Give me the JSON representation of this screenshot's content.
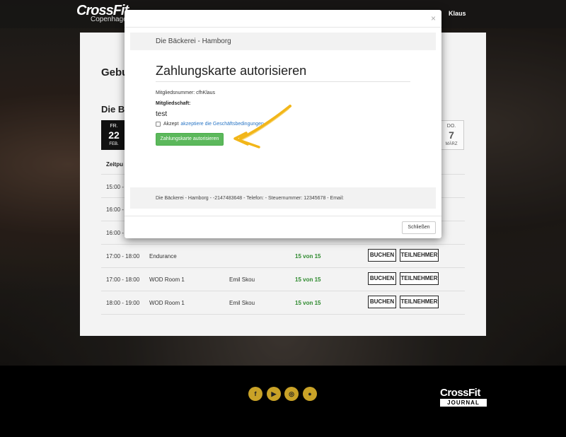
{
  "header": {
    "logo": "CrossFit",
    "logo_sub": "Copenhagen",
    "user": "Klaus"
  },
  "panel": {
    "title": "Gebu",
    "subtitle": "Die Bä",
    "days": [
      {
        "weekday": "FR.",
        "day": "22",
        "month": "FEB.",
        "active": true
      },
      {
        "weekday": "DO.",
        "day": "7",
        "month": "MÄRZ",
        "active": false
      }
    ],
    "table_header": "Zeitpu",
    "rows": [
      {
        "time": "15:00 -",
        "class": "",
        "coach": "",
        "spots": "",
        "book": "",
        "participants": ""
      },
      {
        "time": "16:00 -",
        "class": "",
        "coach": "",
        "spots": "",
        "book": "",
        "participants": ""
      },
      {
        "time": "16:00 -",
        "class": "",
        "coach": "",
        "spots": "",
        "book": "",
        "participants": ""
      },
      {
        "time": "17:00 - 18:00",
        "class": "Endurance",
        "coach": "",
        "spots": "15 von 15",
        "book": "BUCHEN",
        "participants": "TEILNEHMER"
      },
      {
        "time": "17:00 - 18:00",
        "class": "WOD Room 1",
        "coach": "Emil Skou",
        "spots": "15 von 15",
        "book": "BUCHEN",
        "participants": "TEILNEHMER"
      },
      {
        "time": "18:00 - 19:00",
        "class": "WOD Room 1",
        "coach": "Emil Skou",
        "spots": "15 von 15",
        "book": "BUCHEN",
        "participants": "TEILNEHMER"
      }
    ]
  },
  "modal": {
    "close_x": "×",
    "shop_name": "Die Bäckerei - Hamborg",
    "title": "Zahlungskarte autorisieren",
    "member_number": "Mitgliedsnummer: cfhKlaus",
    "membership_label": "Mitgliedschaft:",
    "membership_value": "test",
    "accept_prefix": "Akzept",
    "accept_link": "akzeptiere die Geschäftsbedingungen",
    "authorize_button": "Zahlungskarte autorisieren",
    "footer_text": "Die Bäckerei - Hamborg - -2147483648 - Telefon: - Steuernummer: 12345678 - Email:",
    "close_button": "Schließen"
  },
  "footer": {
    "social_icons": [
      "facebook-icon",
      "youtube-icon",
      "instagram-icon",
      "location-icon"
    ],
    "social_glyphs": [
      "f",
      "▶",
      "◎",
      "●"
    ],
    "journal_title": "CrossFit",
    "journal_sub": "JOURNAL",
    "accent": "#c9a227"
  },
  "colors": {
    "auth_button": "#5cb85c",
    "link": "#2a76c6",
    "arrow": "#f2b619",
    "spots": "#2e8a2e"
  }
}
